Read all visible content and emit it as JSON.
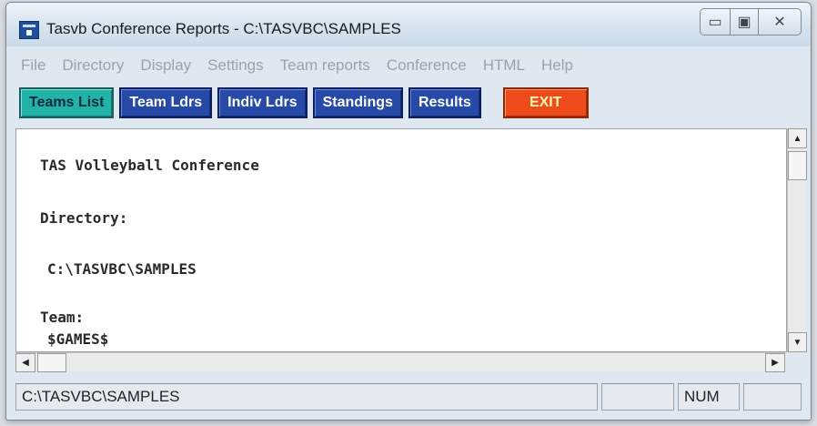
{
  "window": {
    "title": "Tasvb Conference Reports - C:\\TASVBC\\SAMPLES"
  },
  "menu": [
    {
      "label": "File"
    },
    {
      "label": "Directory"
    },
    {
      "label": "Display"
    },
    {
      "label": "Settings"
    },
    {
      "label": "Team reports"
    },
    {
      "label": "Conference"
    },
    {
      "label": "HTML"
    },
    {
      "label": "Help"
    }
  ],
  "toolbar": {
    "teams_list": "Teams List",
    "team_ldrs": "Team Ldrs",
    "indiv_ldrs": "Indiv Ldrs",
    "standings": "Standings",
    "results": "Results",
    "exit": "EXIT"
  },
  "report": {
    "line1": "TAS Volleyball Conference",
    "line2": "Directory:",
    "line3": "C:\\TASVBC\\SAMPLES",
    "line4": "Team:",
    "line5": "$GAMES$"
  },
  "statusbar": {
    "path": "C:\\TASVBC\\SAMPLES",
    "empty": "",
    "num": "NUM",
    "extra": ""
  },
  "icons": {
    "app": "app-icon",
    "minimize": "minimize-icon",
    "maximize": "maximize-icon",
    "close": "close-icon"
  },
  "colors": {
    "teams_list_bg": "#22b3a8",
    "toolbar_button_bg": "#274aa8",
    "exit_bg": "#ef4a1a",
    "exit_text": "#fff7b0"
  }
}
